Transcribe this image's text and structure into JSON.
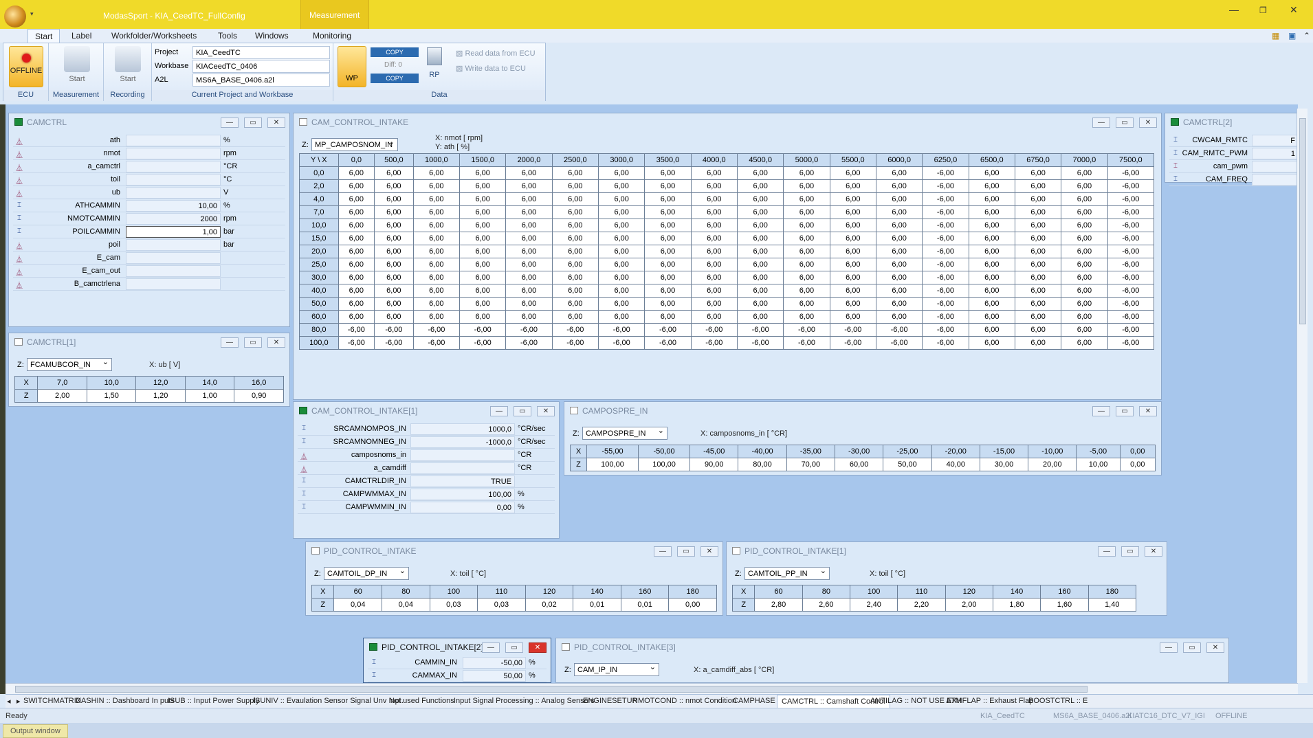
{
  "app": {
    "title": "ModasSport - KIA_CeedTC_FullConfig",
    "context_tab": "Measurement"
  },
  "menu": [
    "Start",
    "Label",
    "Workfolder/Worksheets",
    "Tools",
    "Windows",
    "Monitoring"
  ],
  "ribbon": {
    "ecu": {
      "button": "OFFLINE",
      "group": "ECU"
    },
    "measurement": {
      "button": "Start",
      "group": "Measurement"
    },
    "recording": {
      "button": "Start",
      "group": "Recording"
    },
    "project": {
      "project_label": "Project",
      "project_value": "KIA_CeedTC",
      "workbase_label": "Workbase",
      "workbase_value": "KIACeedTC_0406",
      "a2l_label": "A2L",
      "a2l_value": "MS6A_BASE_0406.a2l",
      "group": "Current Project and Workbase"
    },
    "data": {
      "wp": "WP",
      "copy_top": "COPY",
      "diff": "Diff: 0",
      "copy_bottom": "COPY",
      "rp": "RP",
      "read": "Read data from ECU",
      "write": "Write data to ECU",
      "group": "Data"
    }
  },
  "windows": {
    "camctrl": {
      "title": "CAMCTRL",
      "rows": [
        {
          "name": "ath",
          "value": "",
          "unit": "%",
          "kind": "m"
        },
        {
          "name": "nmot",
          "value": "",
          "unit": "rpm",
          "kind": "m"
        },
        {
          "name": "a_camctrl",
          "value": "",
          "unit": "°CR",
          "kind": "m"
        },
        {
          "name": "toil",
          "value": "",
          "unit": "°C",
          "kind": "m"
        },
        {
          "name": "ub",
          "value": "",
          "unit": "V",
          "kind": "m"
        },
        {
          "name": "ATHCAMMIN",
          "value": "10,00",
          "unit": "%",
          "kind": "c"
        },
        {
          "name": "NMOTCAMMIN",
          "value": "2000",
          "unit": "rpm",
          "kind": "c"
        },
        {
          "name": "POILCAMMIN",
          "value": "1,00",
          "unit": "bar",
          "kind": "c"
        },
        {
          "name": "poil",
          "value": "",
          "unit": "bar",
          "kind": "m"
        },
        {
          "name": "E_cam",
          "value": "",
          "unit": "",
          "kind": "m"
        },
        {
          "name": "E_cam_out",
          "value": "",
          "unit": "",
          "kind": "m"
        },
        {
          "name": "B_camctrlena",
          "value": "",
          "unit": "",
          "kind": "m"
        }
      ]
    },
    "camctrl1": {
      "title": "CAMCTRL[1]",
      "z_label": "Z:",
      "z_select": "FCAMUBCOR_IN",
      "x_axis": "X: ub [ V]",
      "x": [
        "X",
        "7,0",
        "10,0",
        "12,0",
        "14,0",
        "16,0"
      ],
      "z": [
        "Z",
        "2,00",
        "1,50",
        "1,20",
        "1,00",
        "0,90"
      ]
    },
    "cam_control_intake": {
      "title": "CAM_CONTROL_INTAKE",
      "z_label": "Z:",
      "z_select": "MP_CAMPOSNOM_IN",
      "x_axis": "X: nmot [ rpm]",
      "y_axis": "Y: ath [ %]",
      "header": [
        "Y \\ X",
        "0,0",
        "500,0",
        "1000,0",
        "1500,0",
        "2000,0",
        "2500,0",
        "3000,0",
        "3500,0",
        "4000,0",
        "4500,0",
        "5000,0",
        "5500,0",
        "6000,0",
        "6250,0",
        "6500,0",
        "6750,0",
        "7000,0",
        "7500,0"
      ],
      "rows": [
        [
          "0,0",
          "6,00",
          "6,00",
          "6,00",
          "6,00",
          "6,00",
          "6,00",
          "6,00",
          "6,00",
          "6,00",
          "6,00",
          "6,00",
          "6,00",
          "6,00",
          "-6,00",
          "6,00",
          "6,00",
          "6,00",
          "-6,00"
        ],
        [
          "2,0",
          "6,00",
          "6,00",
          "6,00",
          "6,00",
          "6,00",
          "6,00",
          "6,00",
          "6,00",
          "6,00",
          "6,00",
          "6,00",
          "6,00",
          "6,00",
          "-6,00",
          "6,00",
          "6,00",
          "6,00",
          "-6,00"
        ],
        [
          "4,0",
          "6,00",
          "6,00",
          "6,00",
          "6,00",
          "6,00",
          "6,00",
          "6,00",
          "6,00",
          "6,00",
          "6,00",
          "6,00",
          "6,00",
          "6,00",
          "-6,00",
          "6,00",
          "6,00",
          "6,00",
          "-6,00"
        ],
        [
          "7,0",
          "6,00",
          "6,00",
          "6,00",
          "6,00",
          "6,00",
          "6,00",
          "6,00",
          "6,00",
          "6,00",
          "6,00",
          "6,00",
          "6,00",
          "6,00",
          "-6,00",
          "6,00",
          "6,00",
          "6,00",
          "-6,00"
        ],
        [
          "10,0",
          "6,00",
          "6,00",
          "6,00",
          "6,00",
          "6,00",
          "6,00",
          "6,00",
          "6,00",
          "6,00",
          "6,00",
          "6,00",
          "6,00",
          "6,00",
          "-6,00",
          "6,00",
          "6,00",
          "6,00",
          "-6,00"
        ],
        [
          "15,0",
          "6,00",
          "6,00",
          "6,00",
          "6,00",
          "6,00",
          "6,00",
          "6,00",
          "6,00",
          "6,00",
          "6,00",
          "6,00",
          "6,00",
          "6,00",
          "-6,00",
          "6,00",
          "6,00",
          "6,00",
          "-6,00"
        ],
        [
          "20,0",
          "6,00",
          "6,00",
          "6,00",
          "6,00",
          "6,00",
          "6,00",
          "6,00",
          "6,00",
          "6,00",
          "6,00",
          "6,00",
          "6,00",
          "6,00",
          "-6,00",
          "6,00",
          "6,00",
          "6,00",
          "-6,00"
        ],
        [
          "25,0",
          "6,00",
          "6,00",
          "6,00",
          "6,00",
          "6,00",
          "6,00",
          "6,00",
          "6,00",
          "6,00",
          "6,00",
          "6,00",
          "6,00",
          "6,00",
          "-6,00",
          "6,00",
          "6,00",
          "6,00",
          "-6,00"
        ],
        [
          "30,0",
          "6,00",
          "6,00",
          "6,00",
          "6,00",
          "6,00",
          "6,00",
          "6,00",
          "6,00",
          "6,00",
          "6,00",
          "6,00",
          "6,00",
          "6,00",
          "-6,00",
          "6,00",
          "6,00",
          "6,00",
          "-6,00"
        ],
        [
          "40,0",
          "6,00",
          "6,00",
          "6,00",
          "6,00",
          "6,00",
          "6,00",
          "6,00",
          "6,00",
          "6,00",
          "6,00",
          "6,00",
          "6,00",
          "6,00",
          "-6,00",
          "6,00",
          "6,00",
          "6,00",
          "-6,00"
        ],
        [
          "50,0",
          "6,00",
          "6,00",
          "6,00",
          "6,00",
          "6,00",
          "6,00",
          "6,00",
          "6,00",
          "6,00",
          "6,00",
          "6,00",
          "6,00",
          "6,00",
          "-6,00",
          "6,00",
          "6,00",
          "6,00",
          "-6,00"
        ],
        [
          "60,0",
          "6,00",
          "6,00",
          "6,00",
          "6,00",
          "6,00",
          "6,00",
          "6,00",
          "6,00",
          "6,00",
          "6,00",
          "6,00",
          "6,00",
          "6,00",
          "-6,00",
          "6,00",
          "6,00",
          "6,00",
          "-6,00"
        ],
        [
          "80,0",
          "-6,00",
          "-6,00",
          "-6,00",
          "-6,00",
          "-6,00",
          "-6,00",
          "-6,00",
          "-6,00",
          "-6,00",
          "-6,00",
          "-6,00",
          "-6,00",
          "-6,00",
          "-6,00",
          "6,00",
          "6,00",
          "6,00",
          "-6,00"
        ],
        [
          "100,0",
          "-6,00",
          "-6,00",
          "-6,00",
          "-6,00",
          "-6,00",
          "-6,00",
          "-6,00",
          "-6,00",
          "-6,00",
          "-6,00",
          "-6,00",
          "-6,00",
          "-6,00",
          "-6,00",
          "6,00",
          "6,00",
          "6,00",
          "-6,00"
        ]
      ]
    },
    "camctrl2": {
      "title": "CAMCTRL[2]",
      "rows": [
        {
          "name": "CWCAM_RMTC",
          "value": "F"
        },
        {
          "name": "CAM_RMTC_PWM",
          "value": "1"
        },
        {
          "name": "cam_pwm",
          "value": ""
        },
        {
          "name": "CAM_FREQ",
          "value": ""
        }
      ]
    },
    "cam_control_intake1": {
      "title": "CAM_CONTROL_INTAKE[1]",
      "rows": [
        {
          "name": "SRCAMNOMPOS_IN",
          "value": "1000,0",
          "unit": "°CR/sec",
          "kind": "c"
        },
        {
          "name": "SRCAMNOMNEG_IN",
          "value": "-1000,0",
          "unit": "°CR/sec",
          "kind": "c"
        },
        {
          "name": "camposnoms_in",
          "value": "",
          "unit": "°CR",
          "kind": "m"
        },
        {
          "name": "a_camdiff",
          "value": "",
          "unit": "°CR",
          "kind": "m"
        },
        {
          "name": "CAMCTRLDIR_IN",
          "value": "TRUE",
          "unit": "",
          "kind": "c"
        },
        {
          "name": "CAMPWMMAX_IN",
          "value": "100,00",
          "unit": "%",
          "kind": "c"
        },
        {
          "name": "CAMPWMMIN_IN",
          "value": "0,00",
          "unit": "%",
          "kind": "c"
        }
      ]
    },
    "campospre_in": {
      "title": "CAMPOSPRE_IN",
      "z_label": "Z:",
      "z_select": "CAMPOSPRE_IN",
      "x_axis": "X: camposnoms_in [ °CR]",
      "x": [
        "X",
        "-55,00",
        "-50,00",
        "-45,00",
        "-40,00",
        "-35,00",
        "-30,00",
        "-25,00",
        "-20,00",
        "-15,00",
        "-10,00",
        "-5,00",
        "0,00"
      ],
      "z": [
        "Z",
        "100,00",
        "100,00",
        "90,00",
        "80,00",
        "70,00",
        "60,00",
        "50,00",
        "40,00",
        "30,00",
        "20,00",
        "10,00",
        "0,00"
      ]
    },
    "pid_control_intake": {
      "title": "PID_CONTROL_INTAKE",
      "z_label": "Z:",
      "z_select": "CAMTOIL_DP_IN",
      "x_axis": "X: toil [ °C]",
      "x": [
        "X",
        "60",
        "80",
        "100",
        "110",
        "120",
        "140",
        "160",
        "180"
      ],
      "z": [
        "Z",
        "0,04",
        "0,04",
        "0,03",
        "0,03",
        "0,02",
        "0,01",
        "0,01",
        "0,00"
      ]
    },
    "pid_control_intake1": {
      "title": "PID_CONTROL_INTAKE[1]",
      "z_label": "Z:",
      "z_select": "CAMTOIL_PP_IN",
      "x_axis": "X: toil [ °C]",
      "x": [
        "X",
        "60",
        "80",
        "100",
        "110",
        "120",
        "140",
        "160",
        "180"
      ],
      "z": [
        "Z",
        "2,80",
        "2,60",
        "2,40",
        "2,20",
        "2,00",
        "1,80",
        "1,60",
        "1,40"
      ]
    },
    "pid_control_intake2": {
      "title": "PID_CONTROL_INTAKE[2]",
      "rows": [
        {
          "name": "CAMMIN_IN",
          "value": "-50,00",
          "unit": "%"
        },
        {
          "name": "CAMMAX_IN",
          "value": "50,00",
          "unit": "%"
        }
      ]
    },
    "pid_control_intake3": {
      "title": "PID_CONTROL_INTAKE[3]",
      "z_label": "Z:",
      "z_select": "CAM_IP_IN",
      "x_axis": "X: a_camdiff_abs [ °CR]"
    }
  },
  "sheet_tabs": [
    "SWITCHMATRIX",
    "DASHIN :: Dashboard In puts",
    "ISUB :: Input Power Supply",
    "ISUNIV :: Evaulation Sensor Signal Unv Inpt.",
    "Not used Functions",
    "Input Signal Processing :: Analog Sensors",
    "ENGINESETUP",
    "NMOTCOND :: nmot Condition",
    "CAMPHASE",
    "CAMCTRL :: Camshaft Control",
    "ANTILAG :: NOT USE ATM",
    "EXHFLAP :: Exhaust Flap",
    "BOOSTCTRL :: E"
  ],
  "status": {
    "ready": "Ready",
    "project": "KIA_CeedTC",
    "a2l": "MS6A_BASE_0406.a2l",
    "hex": "KIATC16_DTC_V7_IGI",
    "mode": "OFFLINE",
    "output": "Output window"
  }
}
